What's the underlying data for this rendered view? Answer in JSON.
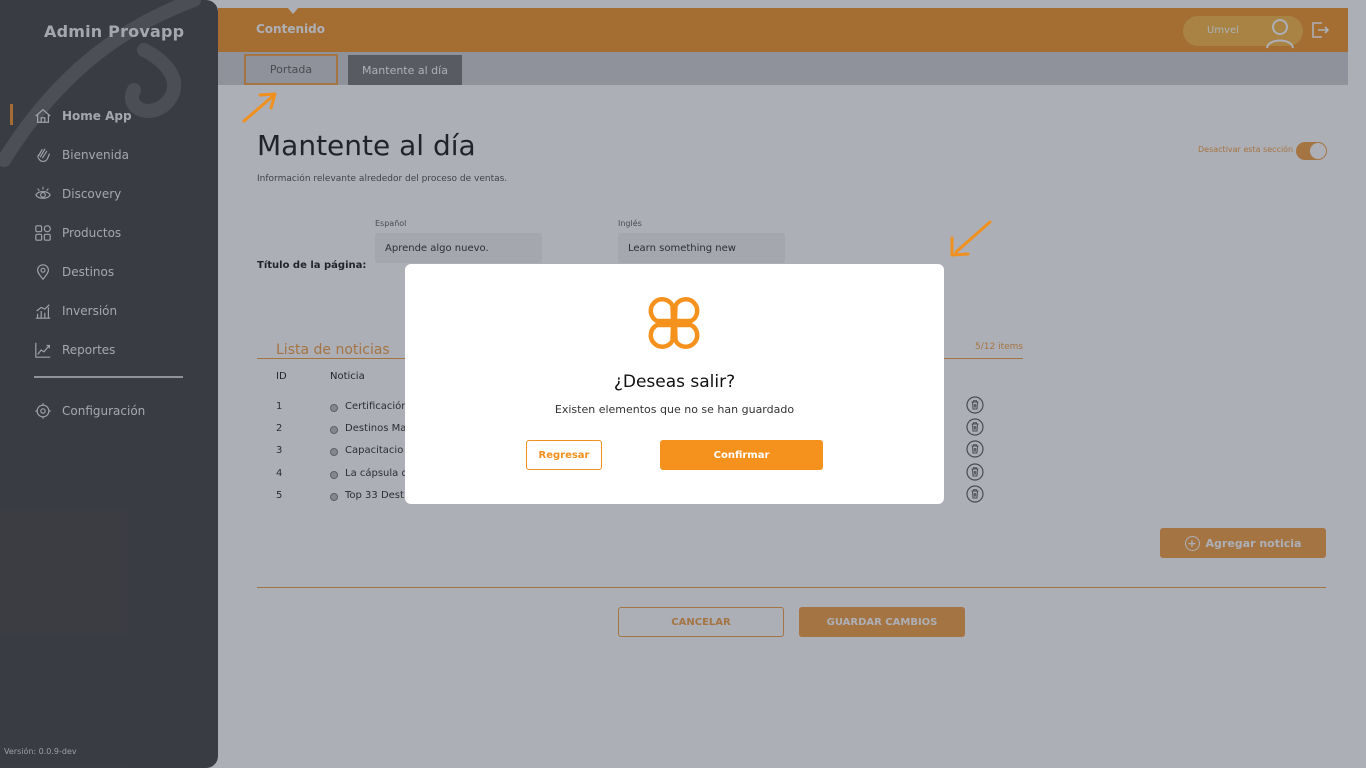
{
  "sidebar": {
    "brand": "Admin Provapp",
    "items": [
      {
        "label": "Home App",
        "icon": "home-icon",
        "active": true
      },
      {
        "label": "Bienvenida",
        "icon": "wave-hand-icon"
      },
      {
        "label": "Discovery",
        "icon": "eye-icon"
      },
      {
        "label": "Productos",
        "icon": "grid-icon"
      },
      {
        "label": "Destinos",
        "icon": "location-pin-icon"
      },
      {
        "label": "Inversión",
        "icon": "bar-chart-icon"
      },
      {
        "label": "Reportes",
        "icon": "line-chart-icon"
      }
    ],
    "settings_label": "Configuración",
    "version": "Versión: 0.0.9-dev"
  },
  "header": {
    "section_title": "Contenido",
    "user_name": "Umvel"
  },
  "tabs": [
    {
      "label": "Portada",
      "highlighted": true
    },
    {
      "label": "Mantente al día",
      "selected": true
    }
  ],
  "page": {
    "title": "Mantente al día",
    "subtitle": "Información relevante alrededor del proceso de ventas.",
    "toggle_label": "Desactivar esta sección",
    "toggle_on": true,
    "title_row_label": "Título de la página:",
    "spanish_label": "Español",
    "spanish_value": "Aprende algo nuevo.",
    "english_label": "Inglés",
    "english_value": "Learn something new"
  },
  "news_list": {
    "title": "Lista de noticias",
    "count": "5/12 items",
    "columns": {
      "id": "ID",
      "title": "Noticia"
    },
    "rows": [
      {
        "id": "1",
        "title": "Certificación"
      },
      {
        "id": "2",
        "title": "Destinos Ma"
      },
      {
        "id": "3",
        "title": "Capacitacio"
      },
      {
        "id": "4",
        "title": "La cápsula d"
      },
      {
        "id": "5",
        "title": "Top 33 Dest"
      }
    ],
    "add_label": "Agregar noticia"
  },
  "footer": {
    "cancel_label": "CANCELAR",
    "save_label": "GUARDAR CAMBIOS"
  },
  "modal": {
    "title": "¿Deseas salir?",
    "message": "Existen elementos que no se han guardado",
    "back_label": "Regresar",
    "confirm_label": "Confirmar"
  },
  "colors": {
    "accent": "#f0901e",
    "sidebar": "#3a3a3a",
    "overlay": "rgba(60,64,80,0.42)"
  }
}
